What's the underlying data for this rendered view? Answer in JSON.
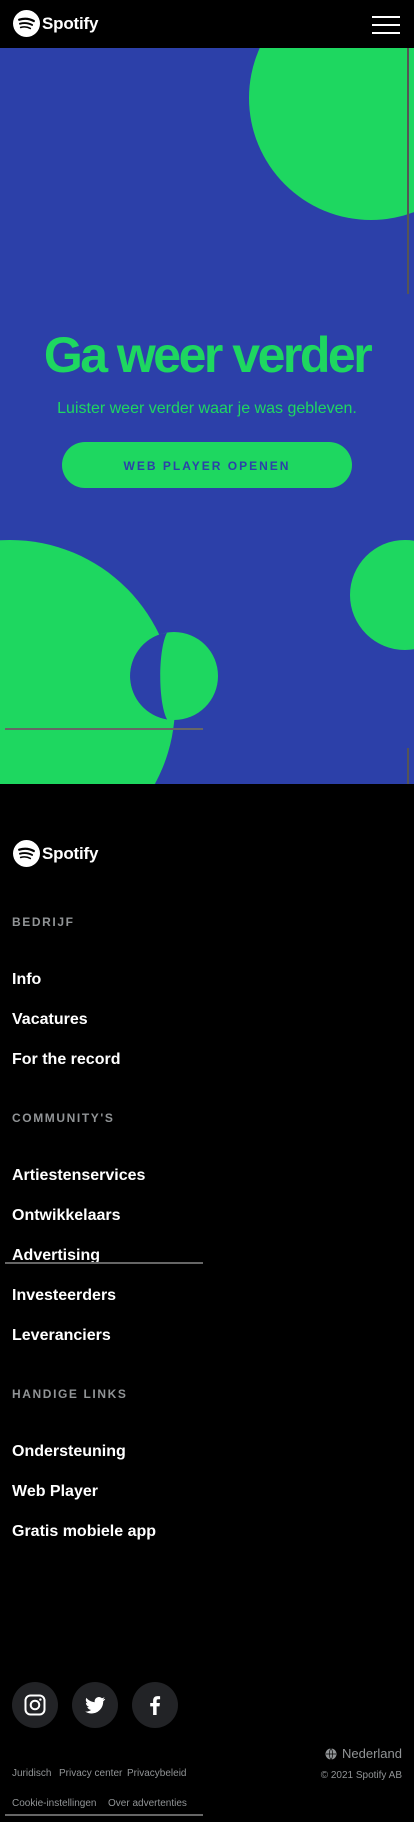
{
  "brand": {
    "name": "Spotify",
    "colors": {
      "green": "#1ed760",
      "blue": "#2c40a9",
      "black": "#000000",
      "muted": "#919496"
    }
  },
  "header": {
    "logo_text": "Spotify",
    "menu_icon": "hamburger-icon"
  },
  "hero": {
    "title": "Ga weer verder",
    "subtitle": "Luister weer verder waar je was gebleven.",
    "button_label": "WEB PLAYER OPENEN"
  },
  "footer": {
    "logo_text": "Spotify",
    "sections": [
      {
        "heading": "BEDRIJF",
        "links": [
          "Info",
          "Vacatures",
          "For the record"
        ]
      },
      {
        "heading": "COMMUNITY'S",
        "links": [
          "Artiestenservices",
          "Ontwikkelaars",
          "Advertising",
          "Investeerders",
          "Leveranciers"
        ]
      },
      {
        "heading": "HANDIGE LINKS",
        "links": [
          "Ondersteuning",
          "Web Player",
          "Gratis mobiele app"
        ]
      }
    ],
    "social": [
      "instagram-icon",
      "twitter-icon",
      "facebook-icon"
    ],
    "region": "Nederland",
    "copyright": "© 2021 Spotify AB",
    "legal_links": [
      "Juridisch",
      "Privacy center",
      "Privacybeleid",
      "Cookie-instellingen",
      "Over advertenties"
    ]
  }
}
